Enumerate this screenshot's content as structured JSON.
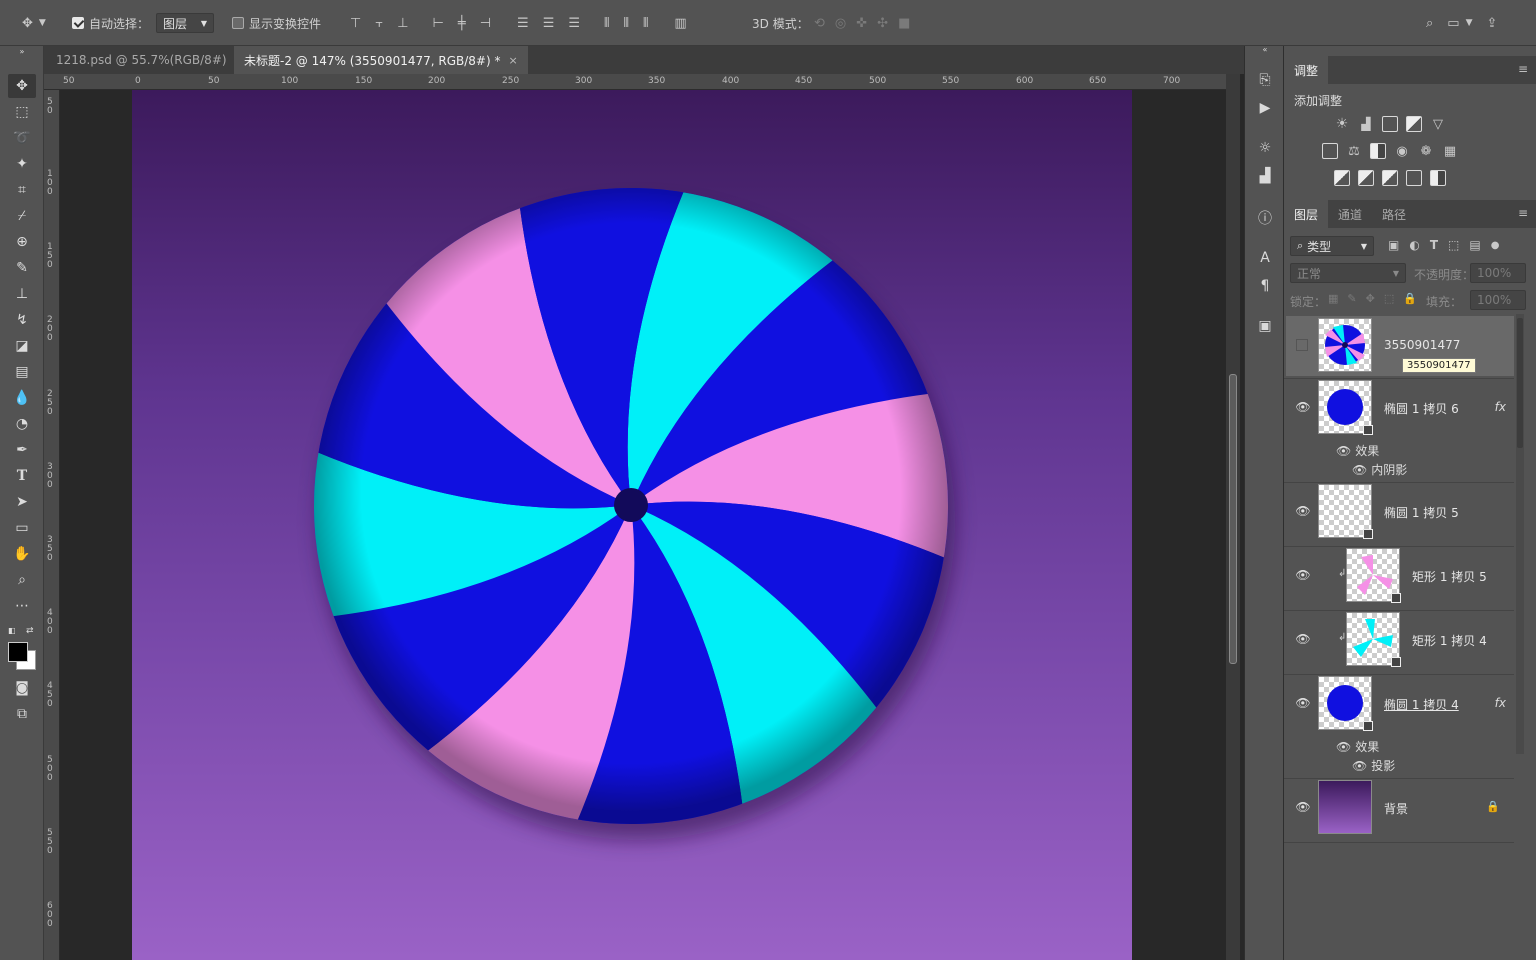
{
  "options_bar": {
    "auto_select_label": "自动选择：",
    "auto_select_value": "图层",
    "show_transform_label": "显示变换控件",
    "mode_3d_label": "3D 模式："
  },
  "doc_tabs": [
    {
      "label": "1218.psd @ 55.7%(RGB/8#)",
      "close": "×"
    },
    {
      "label": "未标题-2 @ 147% (3550901477, RGB/8#) *",
      "close": "×"
    }
  ],
  "ruler_h": [
    "50",
    "0",
    "50",
    "100",
    "150",
    "200",
    "250",
    "300",
    "350",
    "400",
    "450",
    "500",
    "550",
    "600",
    "650",
    "700"
  ],
  "ruler_v": [
    "50",
    "100",
    "150",
    "200",
    "250",
    "300",
    "350",
    "400",
    "450",
    "500",
    "550",
    "600"
  ],
  "adjustments_panel": {
    "tab": "调整",
    "add_label": "添加调整"
  },
  "layers_panel": {
    "tabs": [
      "图层",
      "通道",
      "路径"
    ],
    "filter_kind": "类型",
    "blend_mode": "正常",
    "opacity_label": "不透明度：",
    "opacity_value": "100%",
    "lock_label": "锁定：",
    "fill_label": "填充：",
    "fill_value": "100%",
    "tooltip": "3550901477",
    "fx_label": "fx",
    "layers": [
      {
        "name": "3550901477",
        "thumb": "candy"
      },
      {
        "name": "椭圆 1 拷贝 6",
        "thumb": "blue-circle",
        "has_fx": true,
        "effects_label": "效果",
        "effect": "内阴影"
      },
      {
        "name": "椭圆 1 拷贝 5",
        "thumb": "empty"
      },
      {
        "name": "矩形 1 拷贝 5",
        "thumb": "pink-fan",
        "clipped": true
      },
      {
        "name": "矩形 1 拷贝 4",
        "thumb": "cyan-fan",
        "clipped": true
      },
      {
        "name": "椭圆 1 拷贝 4",
        "thumb": "blue-circle",
        "has_fx": true,
        "effects_label": "效果",
        "effect": "投影"
      },
      {
        "name": "背景",
        "thumb": "bg",
        "locked": true
      }
    ]
  },
  "colors": {
    "candy_blue": "#1010e0",
    "candy_cyan": "#00f0f8",
    "candy_pink": "#f590e6",
    "candy_center": "#120a5a"
  }
}
